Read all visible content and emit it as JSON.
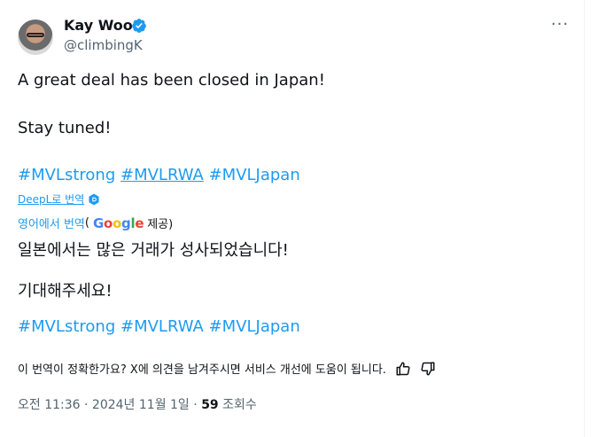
{
  "author": {
    "name": "Kay Woo",
    "handle": "@climbingK",
    "avatar_icon": "avatar-memoji",
    "verified_icon": "verified-badge-icon",
    "verified_color": "#1d9bf0"
  },
  "more_icon": "more-horizontal-icon",
  "more_label": "···",
  "tweet": {
    "line1": "A great deal has been closed in Japan!",
    "line2": "Stay tuned!",
    "hashtags": [
      "#MVLstrong",
      "#MVLRWA",
      "#MVLJapan"
    ]
  },
  "deepl": {
    "label": "DeepL로 번역",
    "icon": "deepl-icon"
  },
  "google": {
    "translated_from": "영어에서 번역",
    "open_paren": "(",
    "logo": [
      "G",
      "o",
      "o",
      "g",
      "l",
      "e"
    ],
    "provided": "제공)"
  },
  "translation": {
    "line1": "일본에서는 많은 거래가 성사되었습니다!",
    "line2": "기대해주세요!",
    "hashtags": [
      "#MVLstrong",
      "#MVLRWA",
      "#MVLJapan"
    ]
  },
  "feedback": {
    "question": "이 번역이 정확한가요? X에 의견을 남겨주시면 서비스 개선에 도움이 됩니다.",
    "thumbs_up_icon": "thumbs-up-icon",
    "thumbs_down_icon": "thumbs-down-icon"
  },
  "meta": {
    "time": "오전 11:36",
    "separator": " · ",
    "date": "2024년 11월 1일",
    "views_count": "59",
    "views_label": "조회수"
  },
  "colors": {
    "link": "#1d9bf0",
    "secondary_text": "#536471",
    "primary_text": "#0f1419"
  }
}
